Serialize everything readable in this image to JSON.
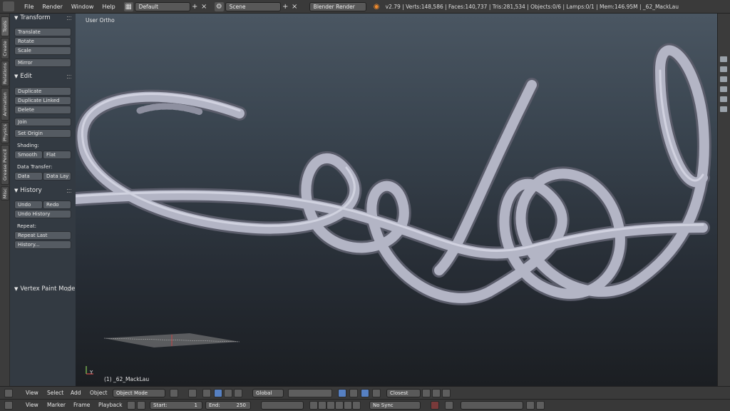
{
  "topbar": {
    "menus": [
      "File",
      "Render",
      "Window",
      "Help"
    ],
    "layout": "Default",
    "scene": "Scene",
    "engine": "Blender Render",
    "stats": "v2.79 | Verts:148,586 | Faces:140,737 | Tris:281,534 | Objects:0/6 | Lamps:0/1 | Mem:146.95M | _62_MackLau"
  },
  "tabs": [
    "Tools",
    "Create",
    "Relations",
    "Animation",
    "Physics",
    "Grease Pencil",
    "Misc"
  ],
  "toolshelf": {
    "transform": {
      "title": "Transform",
      "buttons": [
        "Translate",
        "Rotate",
        "Scale",
        "Mirror"
      ]
    },
    "edit": {
      "title": "Edit",
      "buttons": [
        "Duplicate",
        "Duplicate Linked",
        "Delete",
        "Join",
        "Set Origin"
      ],
      "shading_label": "Shading:",
      "shading": [
        "Smooth",
        "Flat"
      ],
      "transfer_label": "Data Transfer:",
      "transfer": [
        "Data",
        "Data Lay"
      ]
    },
    "history": {
      "title": "History",
      "undo": "Undo",
      "redo": "Redo",
      "undo_history": "Undo History",
      "repeat_label": "Repeat:",
      "repeat_last": "Repeat Last",
      "history": "History..."
    },
    "vertex_paint": "Vertex Paint Mode"
  },
  "viewport": {
    "view_name": "User Ortho",
    "object_label": "(1) _62_MackLau",
    "axis_label": "Y"
  },
  "viewheader": {
    "menus": [
      "View",
      "Select",
      "Add",
      "Object"
    ],
    "mode": "Object Mode",
    "orientation": "Global",
    "snap": "Closest"
  },
  "timeline": {
    "menus": [
      "View",
      "Marker",
      "Frame",
      "Playback"
    ],
    "start_label": "Start:",
    "start": "1",
    "end_label": "End:",
    "end": "250",
    "sync": "No Sync"
  },
  "colors": {
    "ui_bg": "#3a3a3a",
    "shelf_bg": "#333a42",
    "mesh": "#aeb0c0",
    "accent": "#5680c2"
  }
}
